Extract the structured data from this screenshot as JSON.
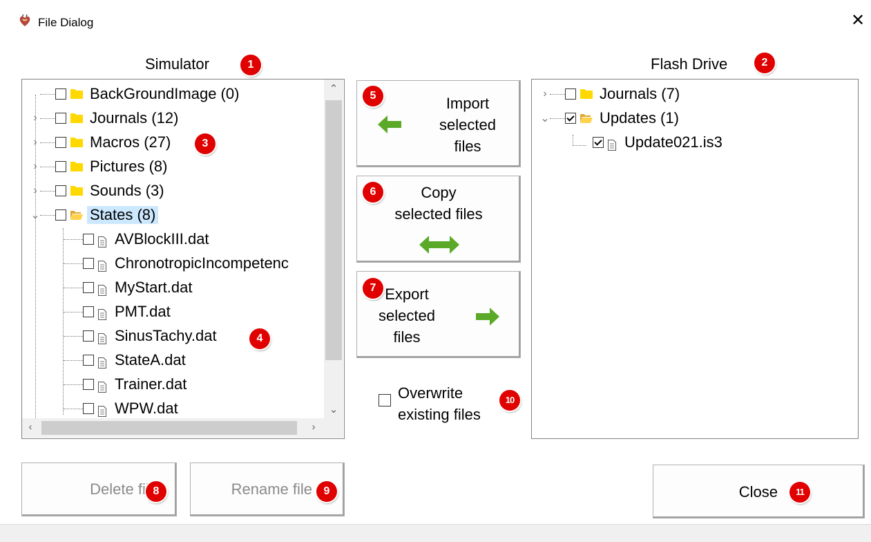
{
  "window": {
    "title": "File Dialog",
    "close_glyph": "✕",
    "icon": "app-heart-icon"
  },
  "simulator": {
    "title": "Simulator",
    "items": [
      {
        "label": "BackGroundImage (0)",
        "type": "folder",
        "expandable": false,
        "checked": false
      },
      {
        "label": "Journals (12)",
        "type": "folder",
        "expandable": true,
        "checked": false
      },
      {
        "label": "Macros (27)",
        "type": "folder",
        "expandable": true,
        "checked": false
      },
      {
        "label": "Pictures (8)",
        "type": "folder",
        "expandable": true,
        "checked": false
      },
      {
        "label": "Sounds (3)",
        "type": "folder",
        "expandable": true,
        "checked": false
      },
      {
        "label": "States (8)",
        "type": "folder-open",
        "expanded": true,
        "checked": false,
        "selected": true
      }
    ],
    "children": [
      {
        "label": "AVBlockIII.dat",
        "checked": false
      },
      {
        "label": "ChronotropicIncompetenc",
        "checked": false
      },
      {
        "label": "MyStart.dat",
        "checked": false
      },
      {
        "label": "PMT.dat",
        "checked": false
      },
      {
        "label": "SinusTachy.dat",
        "checked": false
      },
      {
        "label": "StateA.dat",
        "checked": false
      },
      {
        "label": "Trainer.dat",
        "checked": false
      },
      {
        "label": "WPW.dat",
        "checked": false
      }
    ]
  },
  "flash": {
    "title": "Flash Drive",
    "items": [
      {
        "label": "Journals (7)",
        "type": "folder",
        "expandable": true,
        "checked": false
      },
      {
        "label": "Updates (1)",
        "type": "folder-open",
        "expanded": true,
        "checked": true
      }
    ],
    "children": [
      {
        "label": "Update021.is3",
        "checked": true
      }
    ]
  },
  "buttons": {
    "import": {
      "lines": [
        "Import",
        "selected",
        "files"
      ]
    },
    "copy": {
      "lines": [
        "Copy",
        "selected files"
      ]
    },
    "export": {
      "lines": [
        "Export",
        "selected",
        "files"
      ]
    },
    "delete": "Delete file",
    "rename": "Rename file",
    "close": "Close"
  },
  "overwrite": {
    "lines": [
      "Overwrite",
      "existing files"
    ],
    "checked": false
  },
  "badges": [
    "1",
    "2",
    "3",
    "4",
    "5",
    "6",
    "7",
    "8",
    "9",
    "10",
    "11"
  ],
  "colors": {
    "badge": "#e00000",
    "arrow_green": "#5aa928",
    "folder_yellow": "#ffd800",
    "selection": "#cce8ff"
  }
}
